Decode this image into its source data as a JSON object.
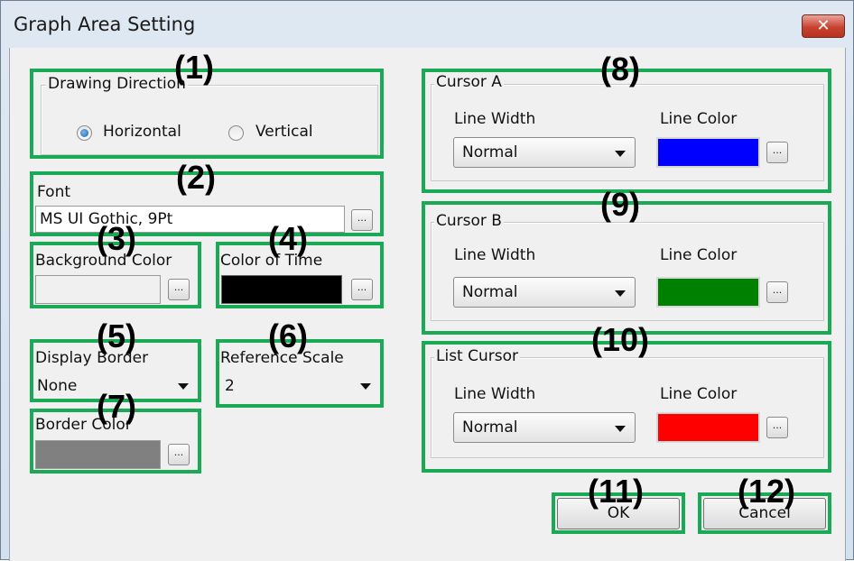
{
  "window": {
    "title": "Graph Area Setting",
    "close_glyph": "✕"
  },
  "callouts": [
    "(1)",
    "(2)",
    "(3)",
    "(4)",
    "(5)",
    "(6)",
    "(7)",
    "(8)",
    "(9)",
    "(10)",
    "(11)",
    "(12)"
  ],
  "drawing_direction": {
    "label": "Drawing Direction",
    "options": [
      "Horizontal",
      "Vertical"
    ],
    "selected": "Horizontal"
  },
  "font": {
    "label": "Font",
    "value": "MS UI Gothic, 9Pt",
    "browse_label": "..."
  },
  "background_color": {
    "label": "Background Color",
    "color": "#ffffff",
    "browse_label": "..."
  },
  "color_of_time": {
    "label": "Color of Time",
    "color": "#000000",
    "browse_label": "..."
  },
  "display_border": {
    "label": "Display Border",
    "value": "None"
  },
  "reference_scale": {
    "label": "Reference Scale",
    "value": "2"
  },
  "border_color": {
    "label": "Border Color",
    "color": "#808080",
    "browse_label": "..."
  },
  "cursors": [
    {
      "title": "Cursor A",
      "width_label": "Line Width",
      "width_value": "Normal",
      "color_label": "Line Color",
      "color": "#0000ff",
      "browse_label": "..."
    },
    {
      "title": "Cursor B",
      "width_label": "Line Width",
      "width_value": "Normal",
      "color_label": "Line Color",
      "color": "#008000",
      "browse_label": "..."
    },
    {
      "title": "List Cursor",
      "width_label": "Line Width",
      "width_value": "Normal",
      "color_label": "Line Color",
      "color": "#ff0000",
      "browse_label": "..."
    }
  ],
  "buttons": {
    "ok": "OK",
    "cancel": "Cancel"
  },
  "accent_colors": {
    "callout_frame": "#1aaa55",
    "close_button": "#c9422f"
  }
}
